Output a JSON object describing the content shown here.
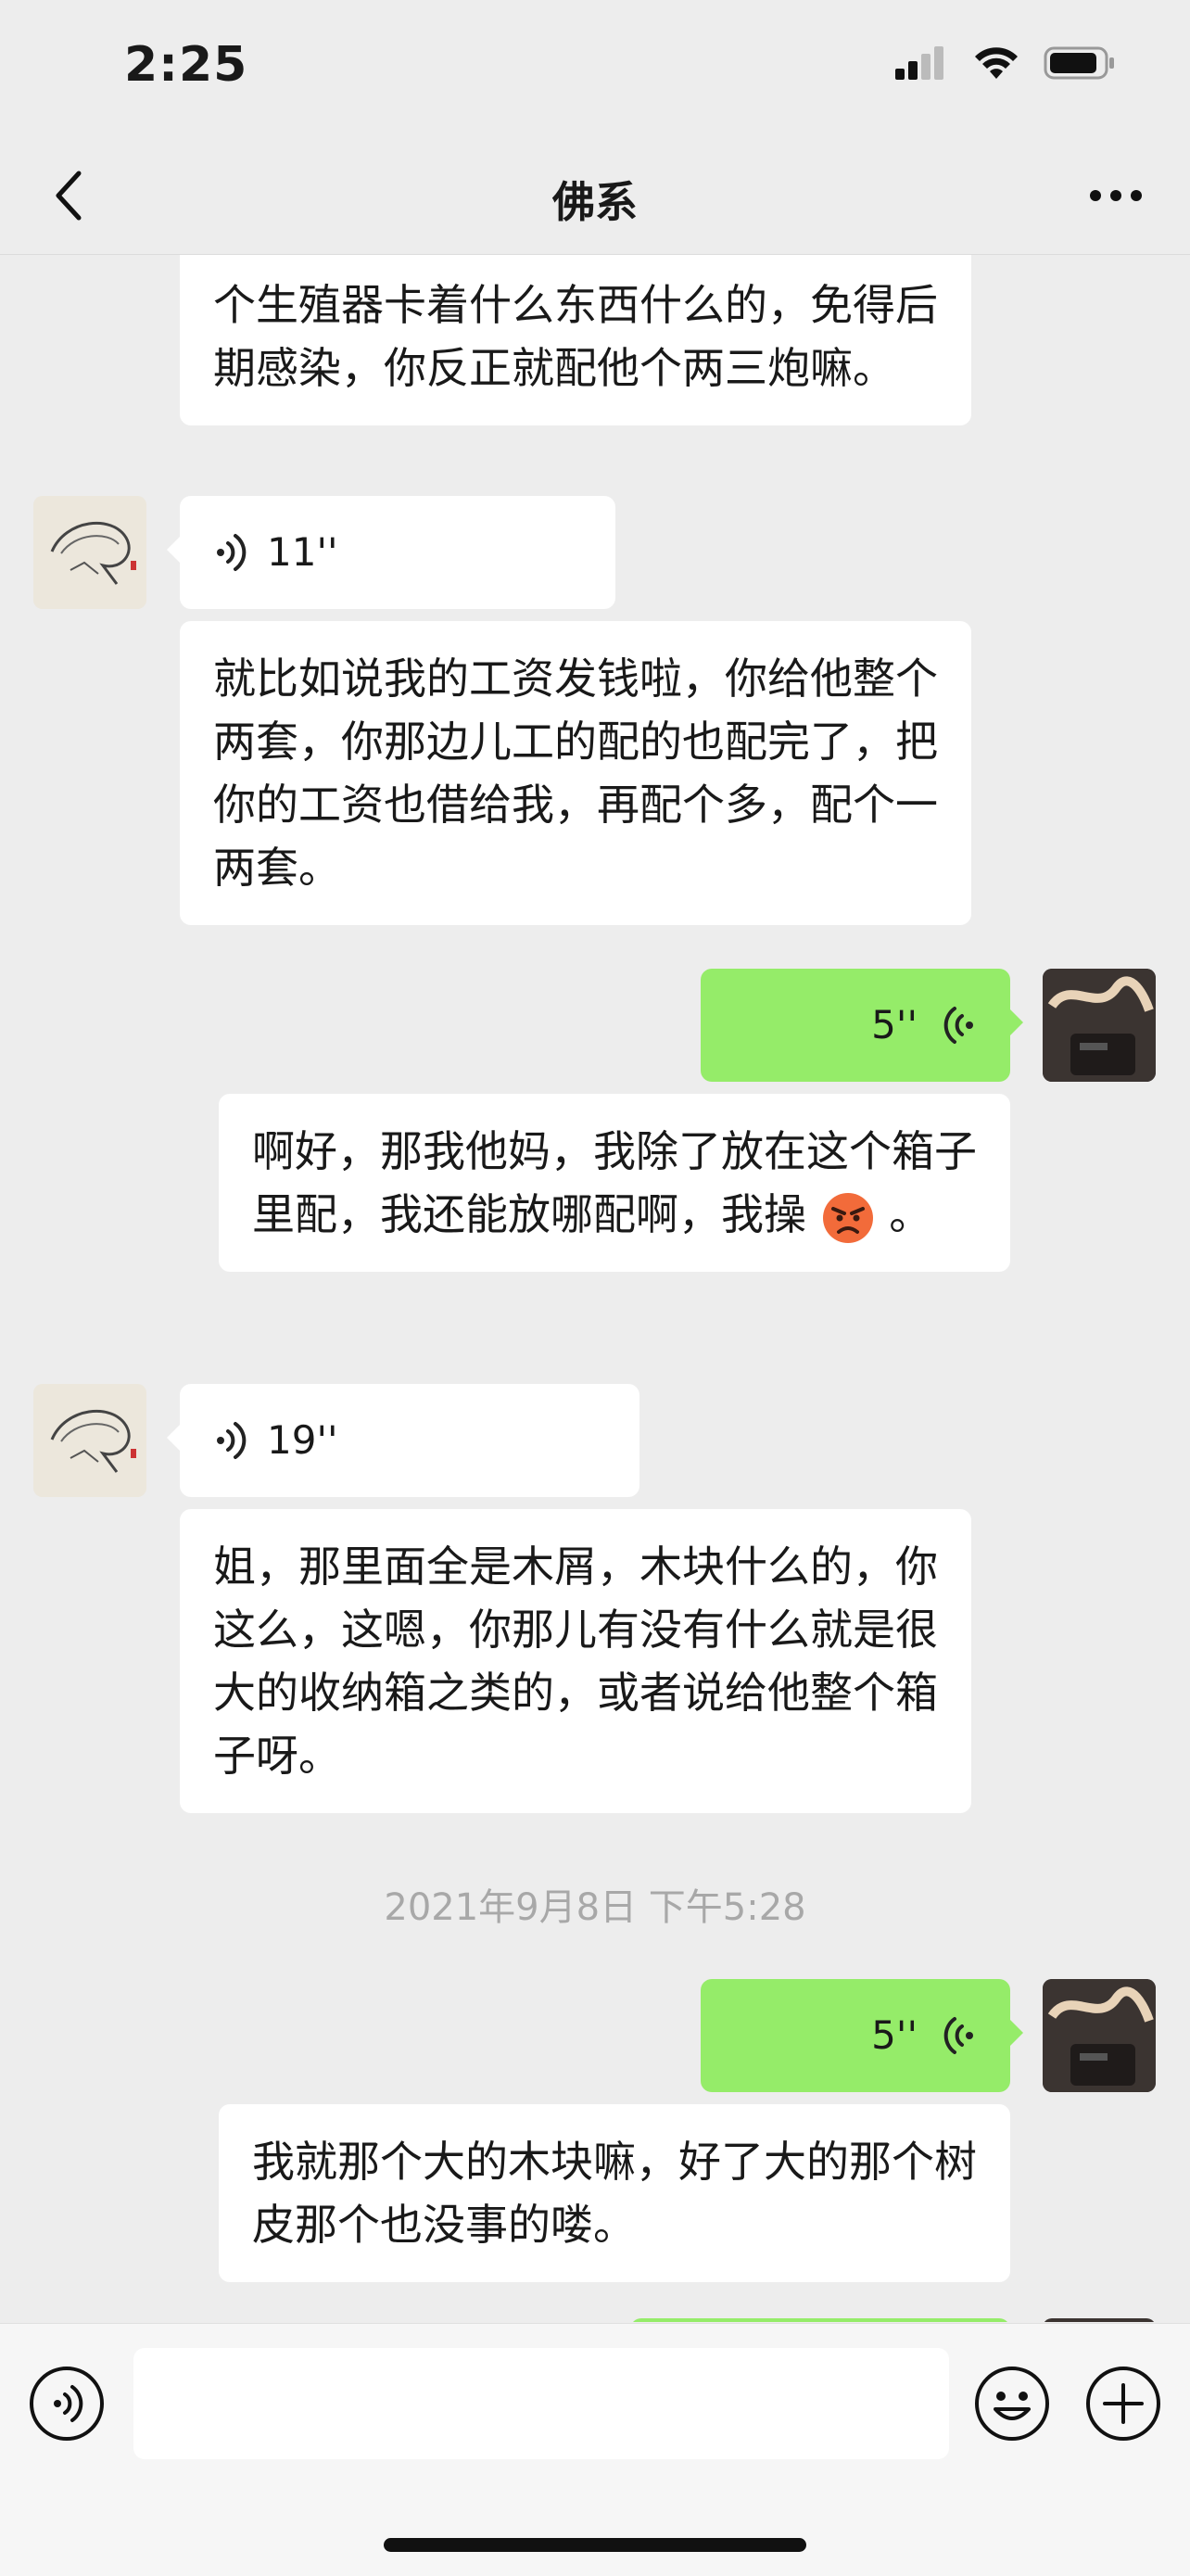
{
  "status_bar": {
    "time": "2:25"
  },
  "nav": {
    "title": "佛系"
  },
  "messages": [
    {
      "text": "个生殖器卡着什么东西什么的，免得后期感染，你反正就配他个两三炮嘛。"
    },
    {
      "duration": "11''"
    },
    {
      "text": "就比如说我的工资发钱啦，你给他整个两套，你那边儿工的配的也配完了，把你的工资也借给我，再配个多，配个一两套。"
    },
    {
      "duration": "5''"
    },
    {
      "text": "啊好，那我他妈，我除了放在这个箱子里配，我还能放哪配啊，我操",
      "suffix": "。"
    },
    {
      "duration": "19''"
    },
    {
      "text": "姐，那里面全是木屑，木块什么的，你这么，这嗯，你那儿有没有什么就是很大的收纳箱之类的，或者说给他整个箱子呀。"
    },
    {
      "timestamp": "2021年9月8日 下午5:28"
    },
    {
      "duration": "5''"
    },
    {
      "text": "我就那个大的木块嘛，好了大的那个树皮那个也没事的喽。"
    }
  ],
  "input": {
    "placeholder": ""
  },
  "colors": {
    "sent_bubble": "#95ec69",
    "received_bubble": "#ffffff",
    "background": "#ededed"
  }
}
